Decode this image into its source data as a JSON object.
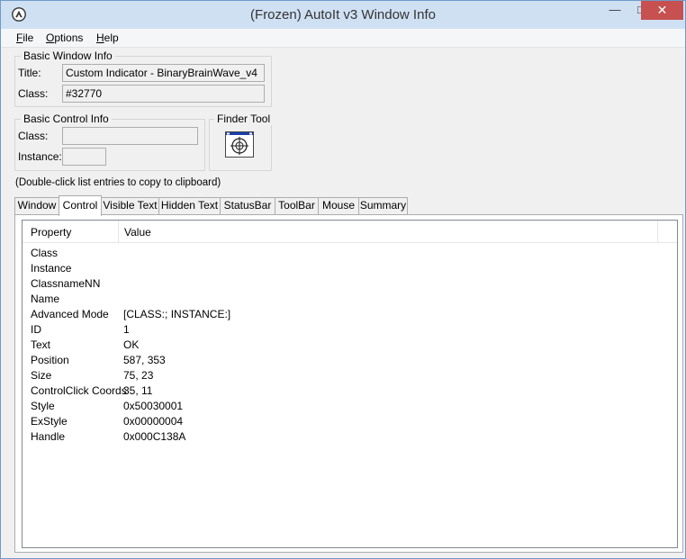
{
  "window": {
    "title": "(Frozen) AutoIt v3 Window Info",
    "minimize_glyph": "—",
    "maximize_glyph": "□",
    "close_glyph": "✕"
  },
  "menu": [
    {
      "label": "File",
      "mnemonic": "F",
      "rest": "ile"
    },
    {
      "label": "Options",
      "mnemonic": "O",
      "rest": "ptions"
    },
    {
      "label": "Help",
      "mnemonic": "H",
      "rest": "elp"
    }
  ],
  "basic_window_info": {
    "group_label": "Basic Window Info",
    "title_label": "Title:",
    "title_value": "Custom Indicator - BinaryBrainWave_v4",
    "class_label": "Class:",
    "class_value": "#32770"
  },
  "basic_control_info": {
    "group_label": "Basic Control Info",
    "class_label": "Class:",
    "class_value": "",
    "instance_label": "Instance:",
    "instance_value": ""
  },
  "finder_tool": {
    "group_label": "Finder Tool",
    "icon": "crosshair-target-icon"
  },
  "hint": "(Double-click list entries to copy to clipboard)",
  "tabs": [
    {
      "label": "Window",
      "active": false
    },
    {
      "label": "Control",
      "active": true
    },
    {
      "label": "Visible Text",
      "active": false
    },
    {
      "label": "Hidden Text",
      "active": false
    },
    {
      "label": "StatusBar",
      "active": false
    },
    {
      "label": "ToolBar",
      "active": false
    },
    {
      "label": "Mouse",
      "active": false
    },
    {
      "label": "Summary",
      "active": false
    }
  ],
  "list": {
    "columns": [
      "Property",
      "Value"
    ],
    "rows": [
      {
        "property": "Class",
        "value": ""
      },
      {
        "property": "Instance",
        "value": ""
      },
      {
        "property": "ClassnameNN",
        "value": ""
      },
      {
        "property": "Name",
        "value": ""
      },
      {
        "property": "Advanced Mode",
        "value": "[CLASS:; INSTANCE:]"
      },
      {
        "property": "ID",
        "value": "1"
      },
      {
        "property": "Text",
        "value": "OK"
      },
      {
        "property": "Position",
        "value": "587, 353"
      },
      {
        "property": "Size",
        "value": "75, 23"
      },
      {
        "property": "ControlClick Coords",
        "value": "35, 11"
      },
      {
        "property": "Style",
        "value": "0x50030001"
      },
      {
        "property": "ExStyle",
        "value": "0x00000004"
      },
      {
        "property": "Handle",
        "value": "0x000C138A"
      }
    ]
  },
  "colors": {
    "titlebar": "#cfe0f3",
    "close_button": "#c75050",
    "window_border": "#6f9bc8",
    "face": "#f0f0f0"
  }
}
